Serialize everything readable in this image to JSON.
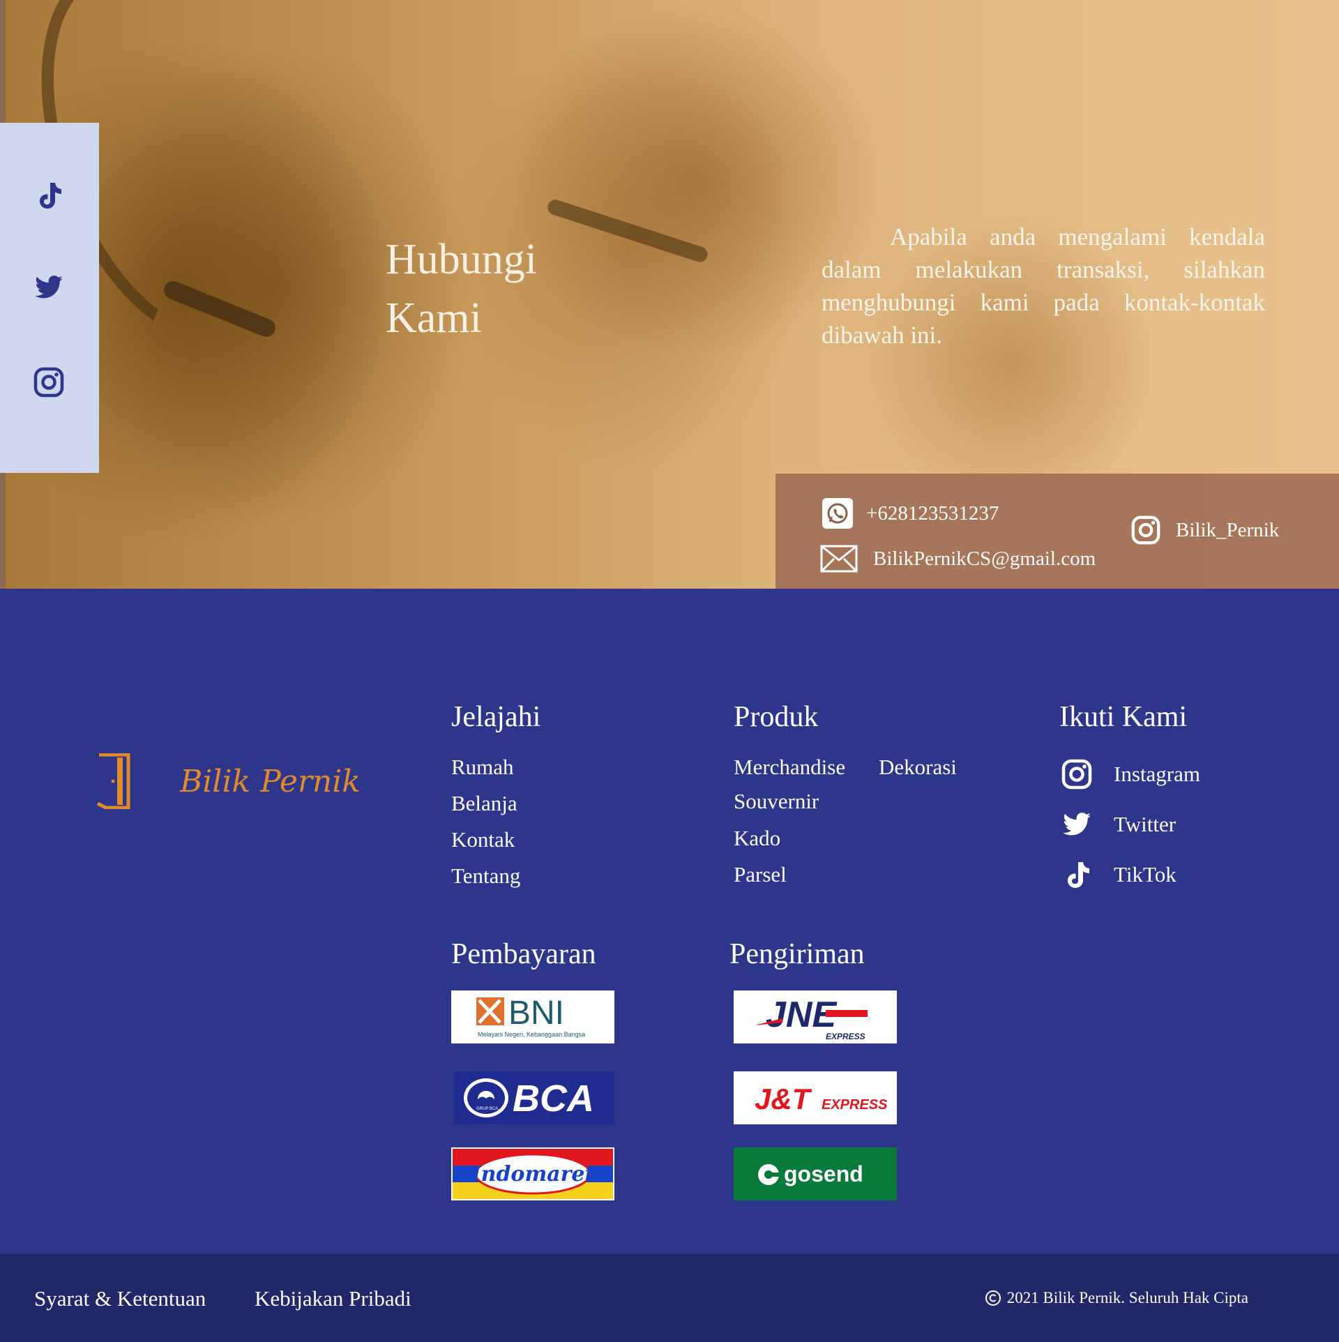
{
  "hero": {
    "title_line1": "Hubungi",
    "title_line2": "Kami",
    "description": "Apabila anda mengalami kendala dalam melakukan transaksi, silahkan menghubungi kami pada kontak-kontak dibawah ini.",
    "side_icons": [
      "tiktok-icon",
      "twitter-icon",
      "instagram-icon"
    ],
    "contacts": {
      "phone": "+628123531237",
      "email": "BilikPernikCS@gmail.com",
      "instagram": "Bilik_Pernik"
    }
  },
  "brand": {
    "name": "Bilik Pernik",
    "accent": "#e08a2a"
  },
  "jelajahi": {
    "heading": "Jelajahi",
    "items": [
      "Rumah",
      "Belanja",
      "Kontak",
      "Tentang"
    ]
  },
  "produk": {
    "heading": "Produk",
    "items": [
      "Merchandise",
      "Dekorasi",
      "Souvernir",
      "Kado",
      "Parsel"
    ]
  },
  "ikuti": {
    "heading": "Ikuti Kami",
    "items": [
      "Instagram",
      "Twitter",
      "TikTok"
    ]
  },
  "pembayaran": {
    "heading": "Pembayaran",
    "logos": {
      "bni": "BNI",
      "bni_tagline": "Melayani Negeri, Kebanggaan Bangsa",
      "bca": "BCA",
      "bca_sub": "GRUP BCA",
      "indomaret": "Indomaret"
    }
  },
  "pengiriman": {
    "heading": "Pengiriman",
    "logos": {
      "jne": "JNE",
      "jne_sub": "EXPRESS",
      "jt": "J&T",
      "jt_sub": "EXPRESS",
      "gosend": "gosend"
    }
  },
  "bottom": {
    "syarat": "Syarat & Ketentuan",
    "kebijakan": "Kebijakan Pribadi",
    "copyright": "2021 Bilik Pernik. Seluruh Hak Cipta"
  },
  "colors": {
    "footer_bg": "#2e368c",
    "bottom_bg": "#22276a",
    "rail_bg": "#cfd8ef",
    "contact_box": "#a06e55"
  }
}
